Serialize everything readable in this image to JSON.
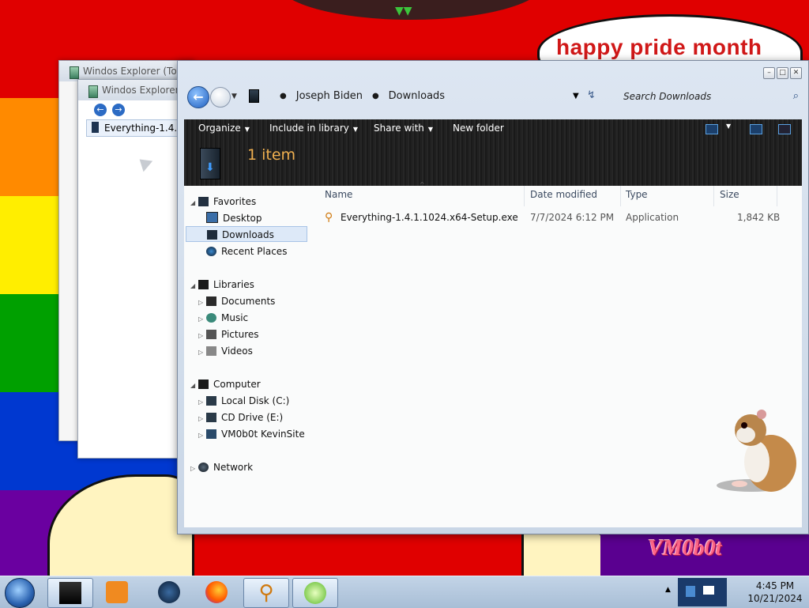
{
  "desktop": {
    "bubble_text": "happy pride month",
    "logo_text": "VM0b0t",
    "pride_colors": [
      "#e00000",
      "#ff8a00",
      "#ffee00",
      "#00a000",
      "#0038d0",
      "#6a00a0"
    ]
  },
  "back_windows": [
    {
      "title": "Windos Explorer (Total"
    },
    {
      "title": "Windos Explorer (T",
      "file": "Everything-1.4.1.1"
    }
  ],
  "window": {
    "caption_buttons": [
      "minimize",
      "maximize",
      "close"
    ],
    "breadcrumb": [
      "Joseph Biden",
      "Downloads"
    ],
    "search_placeholder": "Search Downloads",
    "toolbar": {
      "organize": "Organize",
      "include_in_library": "Include in library",
      "share_with": "Share with",
      "new_folder": "New folder"
    },
    "item_count": "1 item",
    "nav": {
      "favorites": "Favorites",
      "desktop": "Desktop",
      "downloads": "Downloads",
      "recent_places": "Recent Places",
      "libraries": "Libraries",
      "documents": "Documents",
      "music": "Music",
      "pictures": "Pictures",
      "videos": "Videos",
      "computer": "Computer",
      "local_disk": "Local Disk (C:)",
      "cd_drive": "CD Drive (E:)",
      "vm_share": "VM0b0t KevinSite",
      "network": "Network"
    },
    "columns": {
      "name": "Name",
      "date_modified": "Date modified",
      "type": "Type",
      "size": "Size"
    },
    "files": [
      {
        "name": "Everything-1.4.1.1024.x64-Setup.exe",
        "date_modified": "7/7/2024 6:12 PM",
        "type": "Application",
        "size": "1,842 KB"
      }
    ]
  },
  "taskbar": {
    "apps": [
      "explorer-icon",
      "media-player-icon",
      "globe-icon",
      "firefox-icon",
      "everything-search-icon",
      "kiwi-icon"
    ],
    "time": "4:45 PM",
    "date": "10/21/2024"
  }
}
